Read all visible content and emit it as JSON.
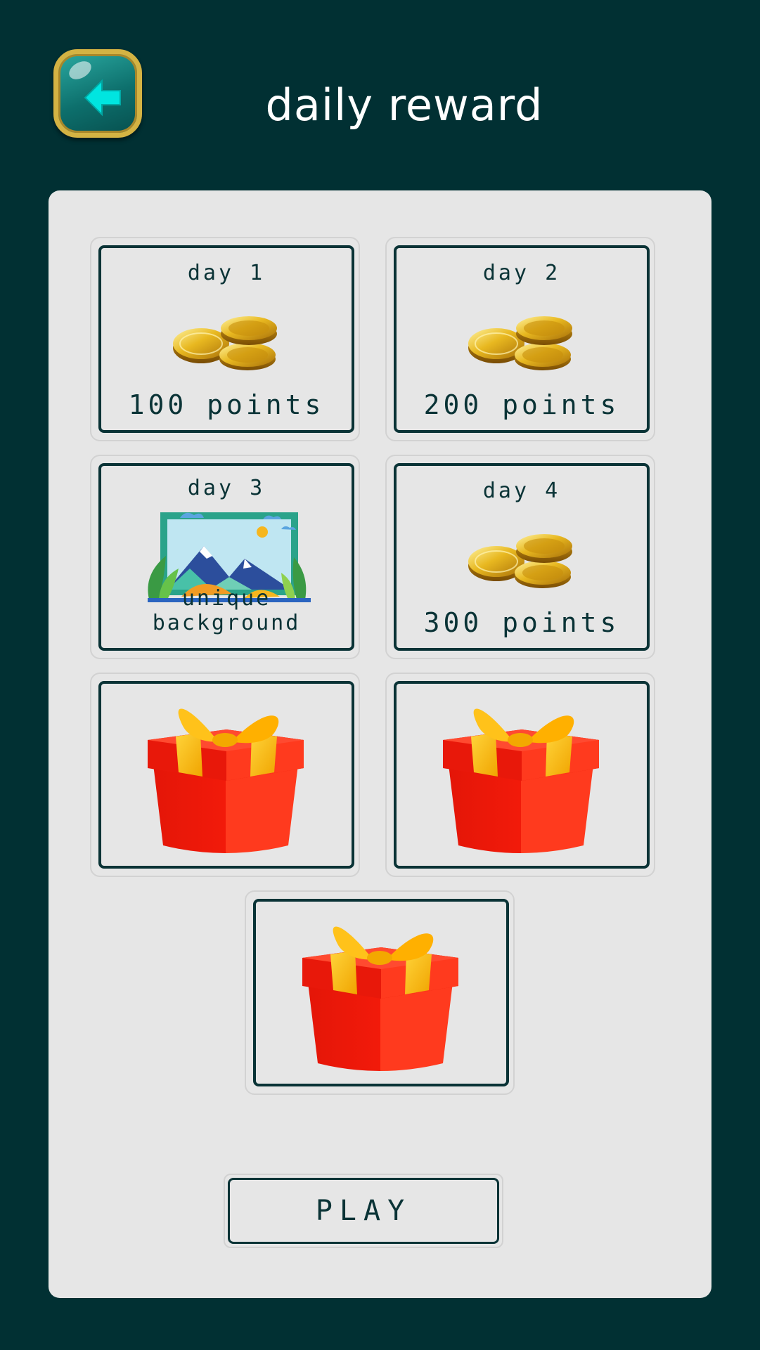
{
  "header": {
    "title": "daily reward",
    "back_icon": "back-arrow-icon"
  },
  "rewards": [
    {
      "day": "day 1",
      "text": "100 points",
      "icon": "gold-coins-icon"
    },
    {
      "day": "day 2",
      "text": "200 points",
      "icon": "gold-coins-icon"
    },
    {
      "day": "day 3",
      "text": "unique background",
      "icon": "landscape-picture-icon"
    },
    {
      "day": "day 4",
      "text": "300 points",
      "icon": "gold-coins-icon"
    },
    {
      "icon": "gift-box-icon"
    },
    {
      "icon": "gift-box-icon"
    },
    {
      "icon": "gift-box-icon"
    }
  ],
  "play_label": "PLAY",
  "colors": {
    "background": "#013033",
    "panel": "#e6e6e6",
    "card_border": "#0a3336",
    "back_button_rim": "#d4b343",
    "back_button_arrow": "#00e5e0"
  }
}
